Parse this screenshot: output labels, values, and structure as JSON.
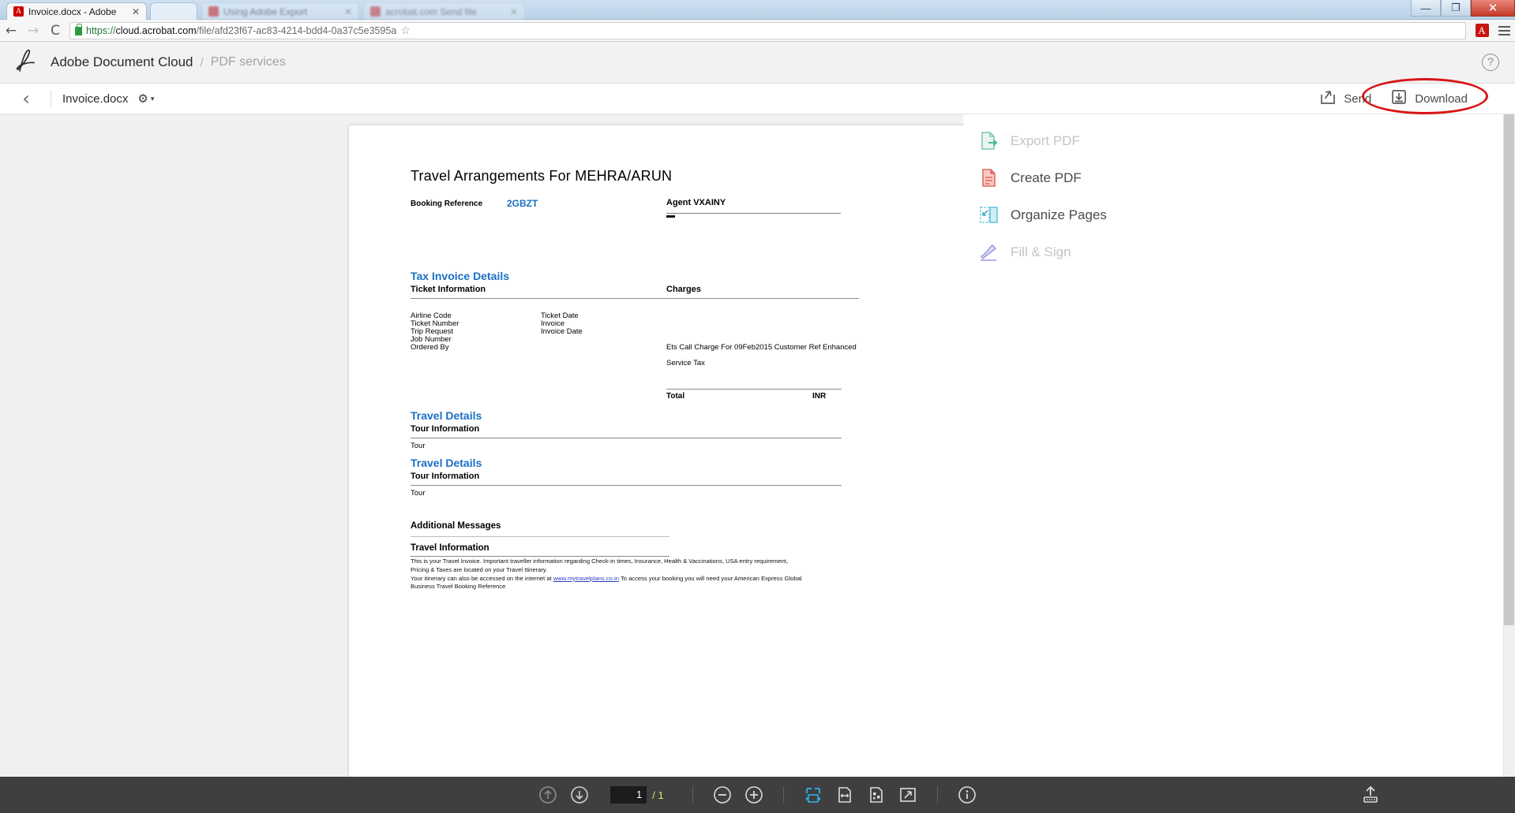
{
  "window": {
    "tabs": [
      {
        "title": "Invoice.docx - Adobe",
        "favicon": "pdf-icon",
        "active": true
      },
      {
        "title": "",
        "favicon": "",
        "active": false
      },
      {
        "title": "Using Adobe Export",
        "favicon": "blur-icon",
        "active": false
      },
      {
        "title": "acrobat.com  Send file",
        "favicon": "blur-icon",
        "active": false
      }
    ],
    "controls": {
      "minimize": "—",
      "maximize": "❐",
      "close": "✕"
    }
  },
  "browser": {
    "back": "←",
    "forward": "→",
    "reload": "⟳",
    "url_scheme": "https://",
    "url_host": "cloud.acrobat.com",
    "url_path": "/file/afd23f67-ac83-4214-bdd4-0a37c5e3595a",
    "bookmark_star": "☆",
    "extension": "acrobat-extension",
    "menu": "chrome-menu"
  },
  "dc_header": {
    "logo": "A",
    "title": "Adobe Document Cloud",
    "separator": "/",
    "subtitle": "PDF services",
    "help": "?"
  },
  "doc_toolbar": {
    "back_label": "‹",
    "file_name": "Invoice.docx",
    "gear": "⚙",
    "caret": "▾",
    "send_label": "Send",
    "download_label": "Download",
    "highlight_color": "#d81414"
  },
  "right_panel": {
    "items": [
      {
        "label": "Export PDF",
        "icon": "export-pdf-icon",
        "enabled": false
      },
      {
        "label": "Create PDF",
        "icon": "create-pdf-icon",
        "enabled": true
      },
      {
        "label": "Organize Pages",
        "icon": "organize-pages-icon",
        "enabled": true
      },
      {
        "label": "Fill & Sign",
        "icon": "fill-sign-icon",
        "enabled": false
      }
    ]
  },
  "document": {
    "title": "Travel Arrangements For MEHRA/ARUN",
    "booking_reference_label": "Booking  Reference",
    "booking_reference_value": "2GBZT",
    "agent": "Agent VXAINY",
    "tax_invoice": {
      "heading": "Tax Invoice Details",
      "col1_header": "Ticket Information",
      "col2_header": "Charges",
      "ticket_fields_left": [
        "Airline Code",
        "Ticket Number",
        "Trip Request",
        "Job Number",
        "Ordered By"
      ],
      "ticket_fields_mid": [
        "Ticket Date",
        "Invoice",
        "Invoice Date"
      ],
      "charge_line": "Ets Call Charge  For 09Feb2015     Customer Ref  Enhanced",
      "service_tax_label": "Service Tax",
      "total_label": "Total",
      "currency": "INR"
    },
    "travel_sections": [
      {
        "heading": "Travel Details",
        "sub": "Tour Information",
        "row": "Tour"
      },
      {
        "heading": "Travel Details",
        "sub": "Tour Information",
        "row": "Tour"
      }
    ],
    "additional_messages_label": "Additional Messages",
    "travel_information_label": "Travel Information",
    "fine_print_1": "This is your Travel Invoice. Important traveller information regarding Check-in times, Insurance, Health & Vaccinations, USA entry requirement, Pricing & Taxes are located on your Travel Itinerary.",
    "fine_print_2a": "Your itinerary can also be accessed on the internet at ",
    "fine_print_link": "www.mytravelplans.co.in",
    "fine_print_2b": " To access your booking you will need your American Express Global Business Travel Booking Reference"
  },
  "bottom_toolbar": {
    "prev_page": "↑",
    "next_page": "↓",
    "page_current": "1",
    "page_total": "/ 1",
    "zoom_out": "−",
    "zoom_in": "+",
    "fit_width_icon": "fit-width-icon",
    "single_page_icon": "single-page-icon",
    "two_page_icon": "two-page-icon",
    "fullscreen_icon": "fullscreen-icon",
    "info_icon": "info-icon",
    "upload_icon": "upload-icon"
  }
}
